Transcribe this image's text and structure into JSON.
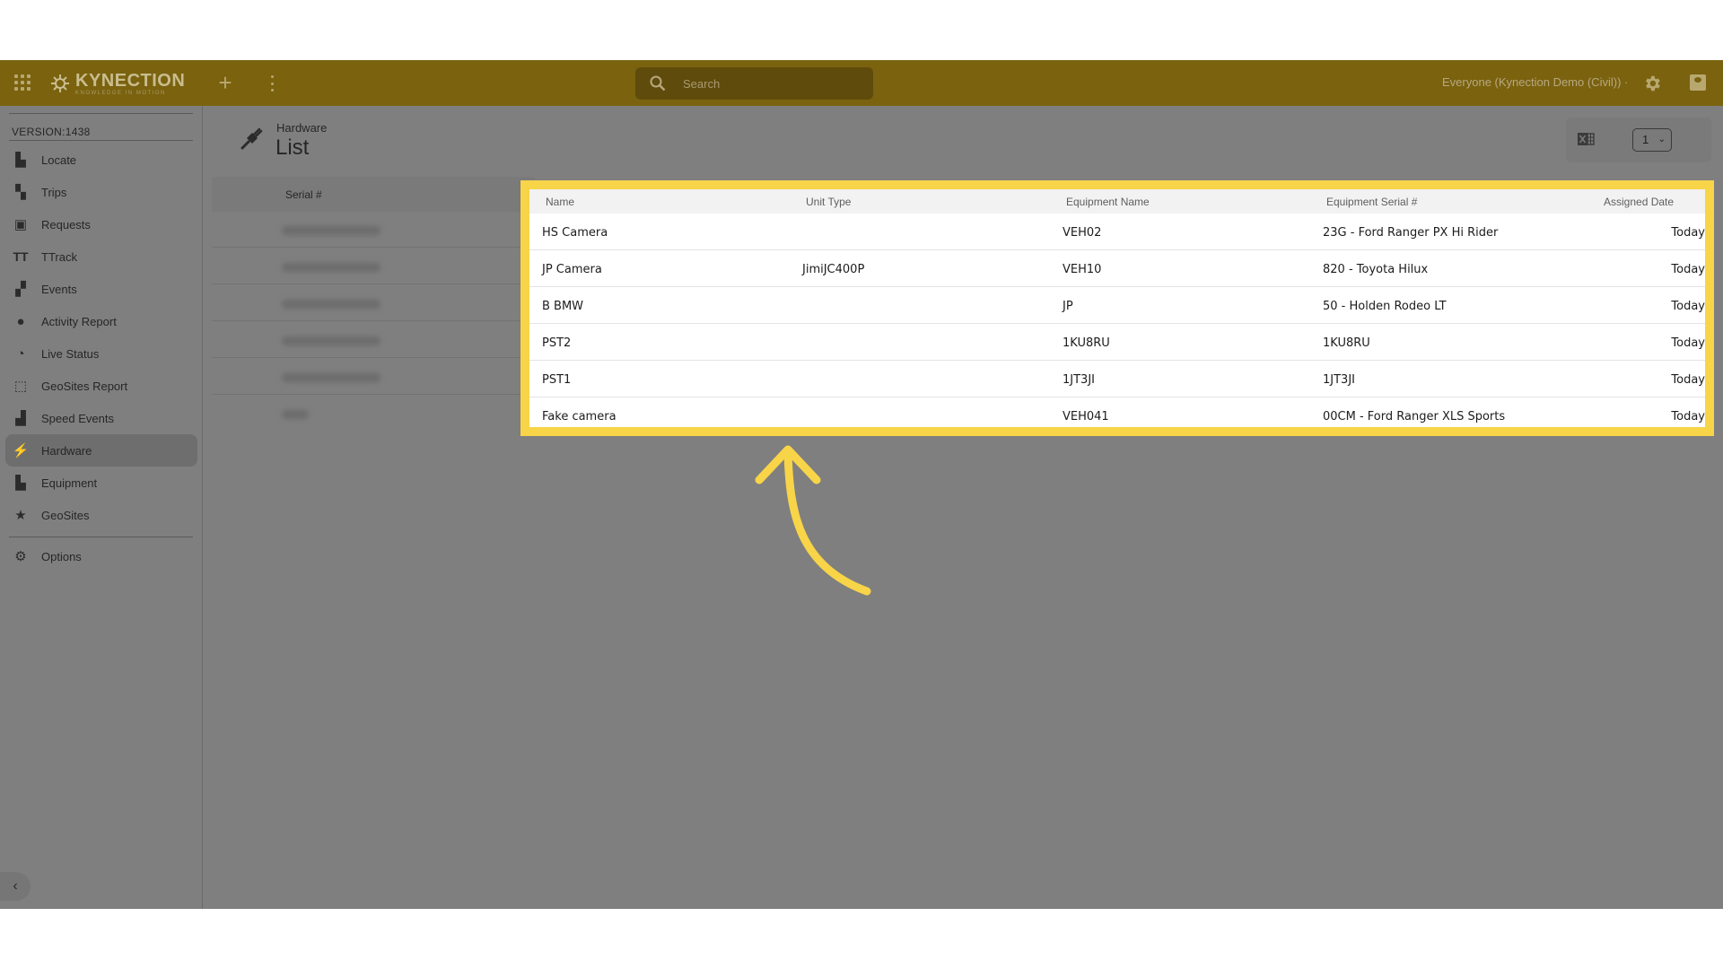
{
  "app": {
    "logo_name": "KYNECTION",
    "logo_tagline": "KNOWLEDGE IN MOTION",
    "search_placeholder": "Search",
    "org_selector": "Everyone (Kynection Demo (Civil)) ·",
    "accent_color": "#f8d448",
    "topbar_color": "#7a620f"
  },
  "sidebar": {
    "version": "VERSION:1438",
    "items": [
      {
        "label": "Locate",
        "icon": "map-icon"
      },
      {
        "label": "Trips",
        "icon": "trips-icon"
      },
      {
        "label": "Requests",
        "icon": "requests-icon"
      },
      {
        "label": "TTrack",
        "icon": "ttrack-icon"
      },
      {
        "label": "Events",
        "icon": "events-icon"
      },
      {
        "label": "Activity Report",
        "icon": "person-pin-icon"
      },
      {
        "label": "Live Status",
        "icon": "live-status-icon"
      },
      {
        "label": "GeoSites Report",
        "icon": "geosites-report-icon"
      },
      {
        "label": "Speed Events",
        "icon": "road-icon"
      },
      {
        "label": "Hardware",
        "icon": "plug-icon"
      },
      {
        "label": "Equipment",
        "icon": "equipment-icon"
      },
      {
        "label": "GeoSites",
        "icon": "star-icon"
      }
    ],
    "options_label": "Options"
  },
  "page": {
    "breadcrumb": "Hardware",
    "title": "List",
    "page_number": "1"
  },
  "background_table": {
    "header": "Serial #"
  },
  "table": {
    "columns": [
      "Name",
      "Unit Type",
      "Equipment Name",
      "Equipment Serial #",
      "Assigned Date"
    ],
    "rows": [
      [
        "HS Camera",
        "",
        "VEH02",
        "23G - Ford Ranger PX Hi Rider",
        "Today"
      ],
      [
        "JP Camera",
        "JimiJC400P",
        "VEH10",
        "820 - Toyota Hilux",
        "Today"
      ],
      [
        "B BMW",
        "",
        "JP",
        "50 - Holden Rodeo LT",
        "Today"
      ],
      [
        "PST2",
        "",
        "1KU8RU",
        "1KU8RU",
        "Today"
      ],
      [
        "PST1",
        "",
        "1JT3JI",
        "1JT3JI",
        "Today"
      ],
      [
        "Fake camera",
        "",
        "VEH041",
        "00CM - Ford Ranger XLS Sports",
        "Today"
      ]
    ]
  }
}
